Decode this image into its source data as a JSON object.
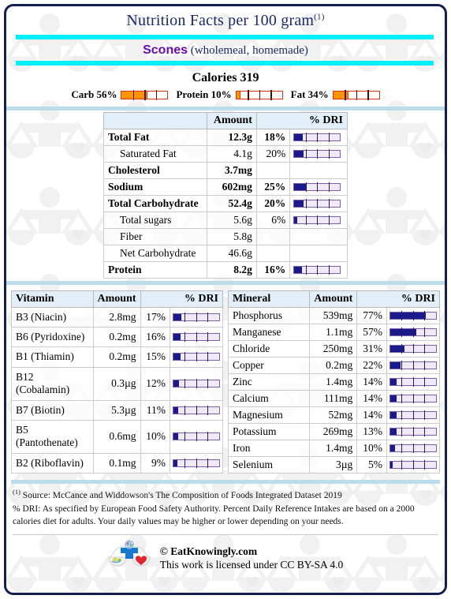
{
  "header": {
    "title": "Nutrition Facts per 100 gram",
    "title_sup": "(1)",
    "food_name": "Scones",
    "food_descriptor": "(wholemeal, homemade)",
    "calories_label": "Calories",
    "calories_value": "319"
  },
  "macros": [
    {
      "label": "Carb 56%",
      "percent": 56
    },
    {
      "label": "Protein 10%",
      "percent": 10
    },
    {
      "label": "Fat 34%",
      "percent": 34
    }
  ],
  "main_table": {
    "headers": {
      "name": "",
      "amount": "Amount",
      "dri": "% DRI"
    },
    "rows": [
      {
        "name": "Total Fat",
        "amount": "12.3g",
        "percent": "18%",
        "bar": 18,
        "bold": true
      },
      {
        "name": "Saturated Fat",
        "amount": "4.1g",
        "percent": "20%",
        "bar": 20,
        "bold": false
      },
      {
        "name": "Cholesterol",
        "amount": "3.7mg",
        "percent": "",
        "bar": null,
        "bold": true
      },
      {
        "name": "Sodium",
        "amount": "602mg",
        "percent": "25%",
        "bar": 25,
        "bold": true
      },
      {
        "name": "Total Carbohydrate",
        "amount": "52.4g",
        "percent": "20%",
        "bar": 20,
        "bold": true
      },
      {
        "name": "Total sugars",
        "amount": "5.6g",
        "percent": "6%",
        "bar": 6,
        "bold": false
      },
      {
        "name": "Fiber",
        "amount": "5.8g",
        "percent": "",
        "bar": null,
        "bold": false
      },
      {
        "name": "Net Carbohydrate",
        "amount": "46.6g",
        "percent": "",
        "bar": null,
        "bold": false
      },
      {
        "name": "Protein",
        "amount": "8.2g",
        "percent": "16%",
        "bar": 16,
        "bold": true
      }
    ]
  },
  "vitamin_table": {
    "headers": {
      "name": "Vitamin",
      "amount": "Amount",
      "dri": "% DRI"
    },
    "rows": [
      {
        "name": "B3 (Niacin)",
        "amount": "2.8mg",
        "percent": "17%",
        "bar": 17
      },
      {
        "name": "B6 (Pyridoxine)",
        "amount": "0.2mg",
        "percent": "16%",
        "bar": 16
      },
      {
        "name": "B1 (Thiamin)",
        "amount": "0.2mg",
        "percent": "15%",
        "bar": 15
      },
      {
        "name": "B12 (Cobalamin)",
        "amount": "0.3µg",
        "percent": "12%",
        "bar": 12
      },
      {
        "name": "B7 (Biotin)",
        "amount": "5.3µg",
        "percent": "11%",
        "bar": 11
      },
      {
        "name": "B5 (Pantothenate)",
        "amount": "0.6mg",
        "percent": "10%",
        "bar": 10
      },
      {
        "name": "B2 (Riboflavin)",
        "amount": "0.1mg",
        "percent": "9%",
        "bar": 9
      }
    ]
  },
  "mineral_table": {
    "headers": {
      "name": "Mineral",
      "amount": "Amount",
      "dri": "% DRI"
    },
    "rows": [
      {
        "name": "Phosphorus",
        "amount": "539mg",
        "percent": "77%",
        "bar": 77
      },
      {
        "name": "Manganese",
        "amount": "1.1mg",
        "percent": "57%",
        "bar": 57
      },
      {
        "name": "Chloride",
        "amount": "250mg",
        "percent": "31%",
        "bar": 31
      },
      {
        "name": "Copper",
        "amount": "0.2mg",
        "percent": "22%",
        "bar": 22
      },
      {
        "name": "Zinc",
        "amount": "1.4mg",
        "percent": "14%",
        "bar": 14
      },
      {
        "name": "Calcium",
        "amount": "111mg",
        "percent": "14%",
        "bar": 14
      },
      {
        "name": "Magnesium",
        "amount": "52mg",
        "percent": "14%",
        "bar": 14
      },
      {
        "name": "Potassium",
        "amount": "269mg",
        "percent": "13%",
        "bar": 13
      },
      {
        "name": "Iron",
        "amount": "1.4mg",
        "percent": "10%",
        "bar": 10
      },
      {
        "name": "Selenium",
        "amount": "3µg",
        "percent": "5%",
        "bar": 5
      }
    ]
  },
  "footer": {
    "source_sup": "(1)",
    "source_text": "Source: McCance and Widdowson's The Composition of Foods Integrated Dataset 2019",
    "dri_note": "% DRI: As specified by European Food Safety Authority. Percent Daily Reference Intakes are based on a 2000 calories diet for adults. Your daily values may be higher or lower depending on your needs.",
    "copyright": "© EatKnowingly.com",
    "license": "This work is licensed under CC BY-SA 4.0"
  },
  "colors": {
    "frame": "#151f4f",
    "cyan": "#00f0ff",
    "title": "#1c2a63",
    "food": "#6a0dad",
    "macro_fill": "#ff9500",
    "macro_border": "#e03010",
    "dri_fill": "#1a1a8c",
    "dri_border": "#7b5ea7",
    "dri_track": "#f0eaf8",
    "table_header": "#e2eef8",
    "section_rule": "#bcdcec"
  }
}
